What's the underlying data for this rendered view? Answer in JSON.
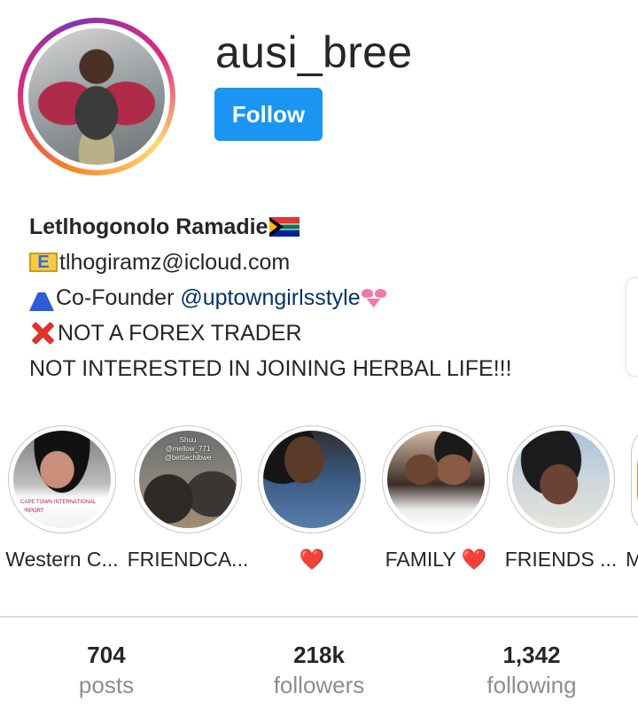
{
  "profile": {
    "username": "ausi_bree",
    "follow_label": "Follow"
  },
  "bio": {
    "name": "Letlhogonolo Ramadie",
    "email": "tlhogiramz@icloud.com",
    "role_prefix": "Co-Founder ",
    "mention": "@uptowngirlsstyle",
    "line3": "NOT A FOREX TRADER",
    "line4": "NOT INTERESTED IN JOINING HERBAL LIFE!!!",
    "emoji_letter": "E"
  },
  "highlights": [
    {
      "label": "Western C...",
      "overlay": "CAPE TOWN INTERNATIONAL AIRPORT"
    },
    {
      "label": "FRIENDCA...",
      "overlay_lines": [
        "Shuu",
        "@mellow_771",
        "@bettiechibwe"
      ]
    },
    {
      "label": "❤️"
    },
    {
      "label": "FAMILY ❤️"
    },
    {
      "label": "FRIENDS ..."
    },
    {
      "label": "M"
    }
  ],
  "stats": [
    {
      "value": "704",
      "label": "posts"
    },
    {
      "value": "218k",
      "label": "followers"
    },
    {
      "value": "1,342",
      "label": "following"
    }
  ],
  "colors": {
    "follow_button": "#1b95f2",
    "mention": "#003569",
    "stat_label": "#8e8e8e"
  }
}
